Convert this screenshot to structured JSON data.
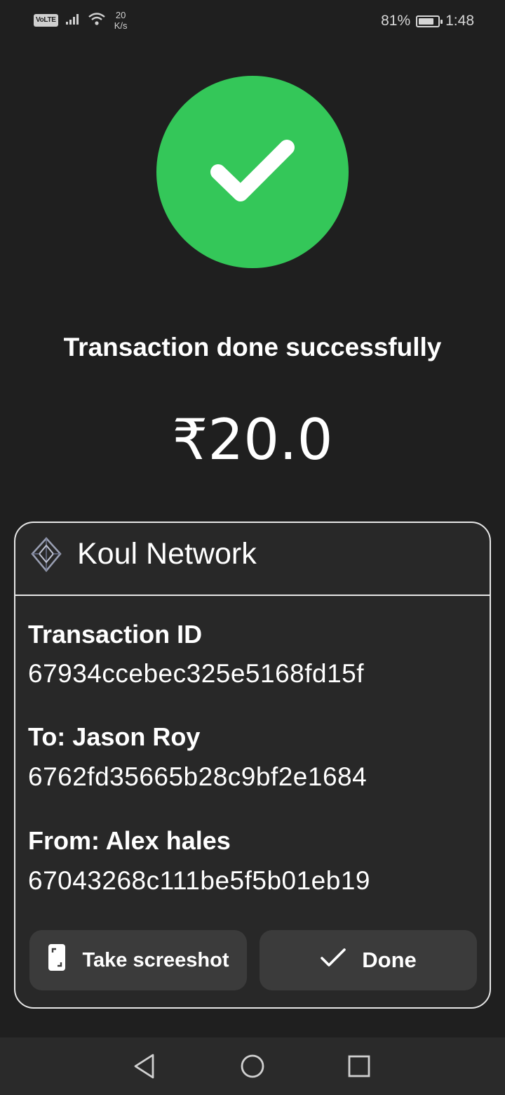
{
  "status_bar": {
    "volte": "VoLTE",
    "speed_value": "20",
    "speed_unit": "K/s",
    "battery_percent": "81%",
    "battery_level": 0.81,
    "time": "1:48",
    "icons": [
      "signal-icon",
      "wifi-icon",
      "battery-icon"
    ]
  },
  "success": {
    "icon": "checkmark-icon",
    "color": "#34c759",
    "message": "Transaction done successfully",
    "amount": "₹20.0"
  },
  "card": {
    "network_name": "Koul Network",
    "transaction_label": "Transaction ID",
    "transaction_id": "67934ccebec325e5168fd15f",
    "to_label": "To: Jason Roy",
    "to_id": "6762fd35665b28c9bf2e1684",
    "from_label": "From: Alex hales",
    "from_id": "67043268c111be5f5b01eb19",
    "screenshot_button": "Take screeshot",
    "done_button": "Done"
  },
  "nav_bar": {
    "icons": [
      "back-icon",
      "home-icon",
      "recents-icon"
    ]
  }
}
